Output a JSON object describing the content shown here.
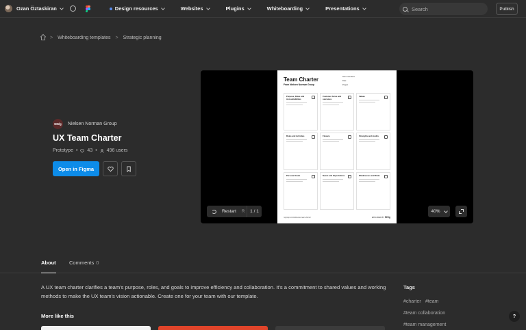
{
  "topbar": {
    "username": "Ozan Öztaskiran",
    "nav": [
      "Design resources",
      "Websites",
      "Plugins",
      "Whiteboarding",
      "Presentations"
    ],
    "search_placeholder": "Search",
    "publish_label": "Publish"
  },
  "breadcrumb": [
    "Whiteboarding templates",
    "Strategic planning"
  ],
  "file": {
    "creator": "Nielsen Norman Group",
    "creator_logo_text": "NN/g",
    "title": "UX Team Charter",
    "type": "Prototype",
    "likes": "43",
    "users": "496 users",
    "open_label": "Open in Figma"
  },
  "preview": {
    "doc_title": "Team Charter",
    "doc_subtitle": "From Nielsen Norman Group",
    "doc_side": [
      "Team members",
      "Date",
      "Project"
    ],
    "cards": [
      {
        "title": "Purpose, Roles and Accountabilities"
      },
      {
        "title": "Customer focus and outcomes"
      },
      {
        "title": "Values"
      },
      {
        "title": "Roles and Activities"
      },
      {
        "title": "Finance"
      },
      {
        "title": "Strengths and doubts"
      },
      {
        "title": "Personal Goals"
      },
      {
        "title": "Needs and Expectations"
      },
      {
        "title": "Weaknesses and Risks"
      }
    ],
    "doc_footer": "nngroup.com/articles/ux-team-charter",
    "doc_footer_right": "EXPLORED BY",
    "doc_footer_logo": "NN/g",
    "restart_label": "Restart",
    "restart_key": "R",
    "page": "1 / 1",
    "zoom": "40%"
  },
  "tabs": {
    "about": "About",
    "comments": "Comments",
    "comments_count": "0"
  },
  "description": "A UX team charter clarifies a team's purpose, roles, and goals to improve efficiency and collaboration. It's a commitment to shared values and working methods to make the UX team's vision actionable. Create one for your team with our template.",
  "more_like_this": "More like this",
  "tags": {
    "title": "Tags",
    "items": [
      "#charter",
      "#team",
      "#team collaboration",
      "#team management"
    ]
  },
  "help_label": "?",
  "colors": {
    "accent": "#0d8ce9",
    "background": "#2c2c2c"
  }
}
